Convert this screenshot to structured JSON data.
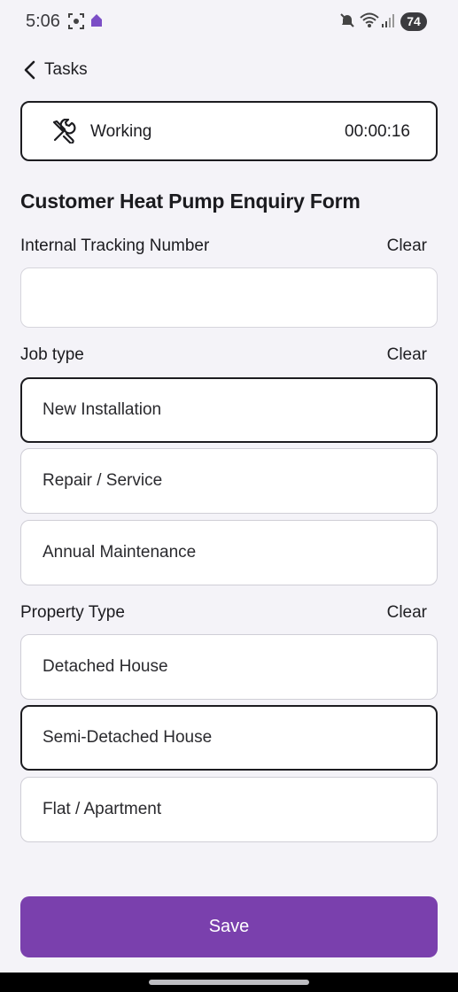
{
  "status_bar": {
    "time": "5:06",
    "battery": "74",
    "icons": [
      "screenshot-icon",
      "home-app-icon",
      "mute-icon",
      "wifi-icon",
      "signal-icon"
    ]
  },
  "nav": {
    "back_label": "Tasks"
  },
  "timer": {
    "status": "Working",
    "elapsed": "00:00:16",
    "icon": "tools-icon"
  },
  "form": {
    "title": "Customer Heat Pump Enquiry Form",
    "tracking": {
      "label": "Internal Tracking Number",
      "clear": "Clear",
      "value": ""
    },
    "job_type": {
      "label": "Job type",
      "clear": "Clear",
      "options": [
        "New Installation",
        "Repair / Service",
        "Annual Maintenance"
      ],
      "selected": "New Installation"
    },
    "property_type": {
      "label": "Property Type",
      "clear": "Clear",
      "options": [
        "Detached House",
        "Semi-Detached House",
        "Flat / Apartment"
      ],
      "selected": "Semi-Detached House"
    },
    "save_label": "Save"
  },
  "colors": {
    "accent": "#7a40ad",
    "background": "#f4f3f8",
    "border_selected": "#1c1c20"
  }
}
